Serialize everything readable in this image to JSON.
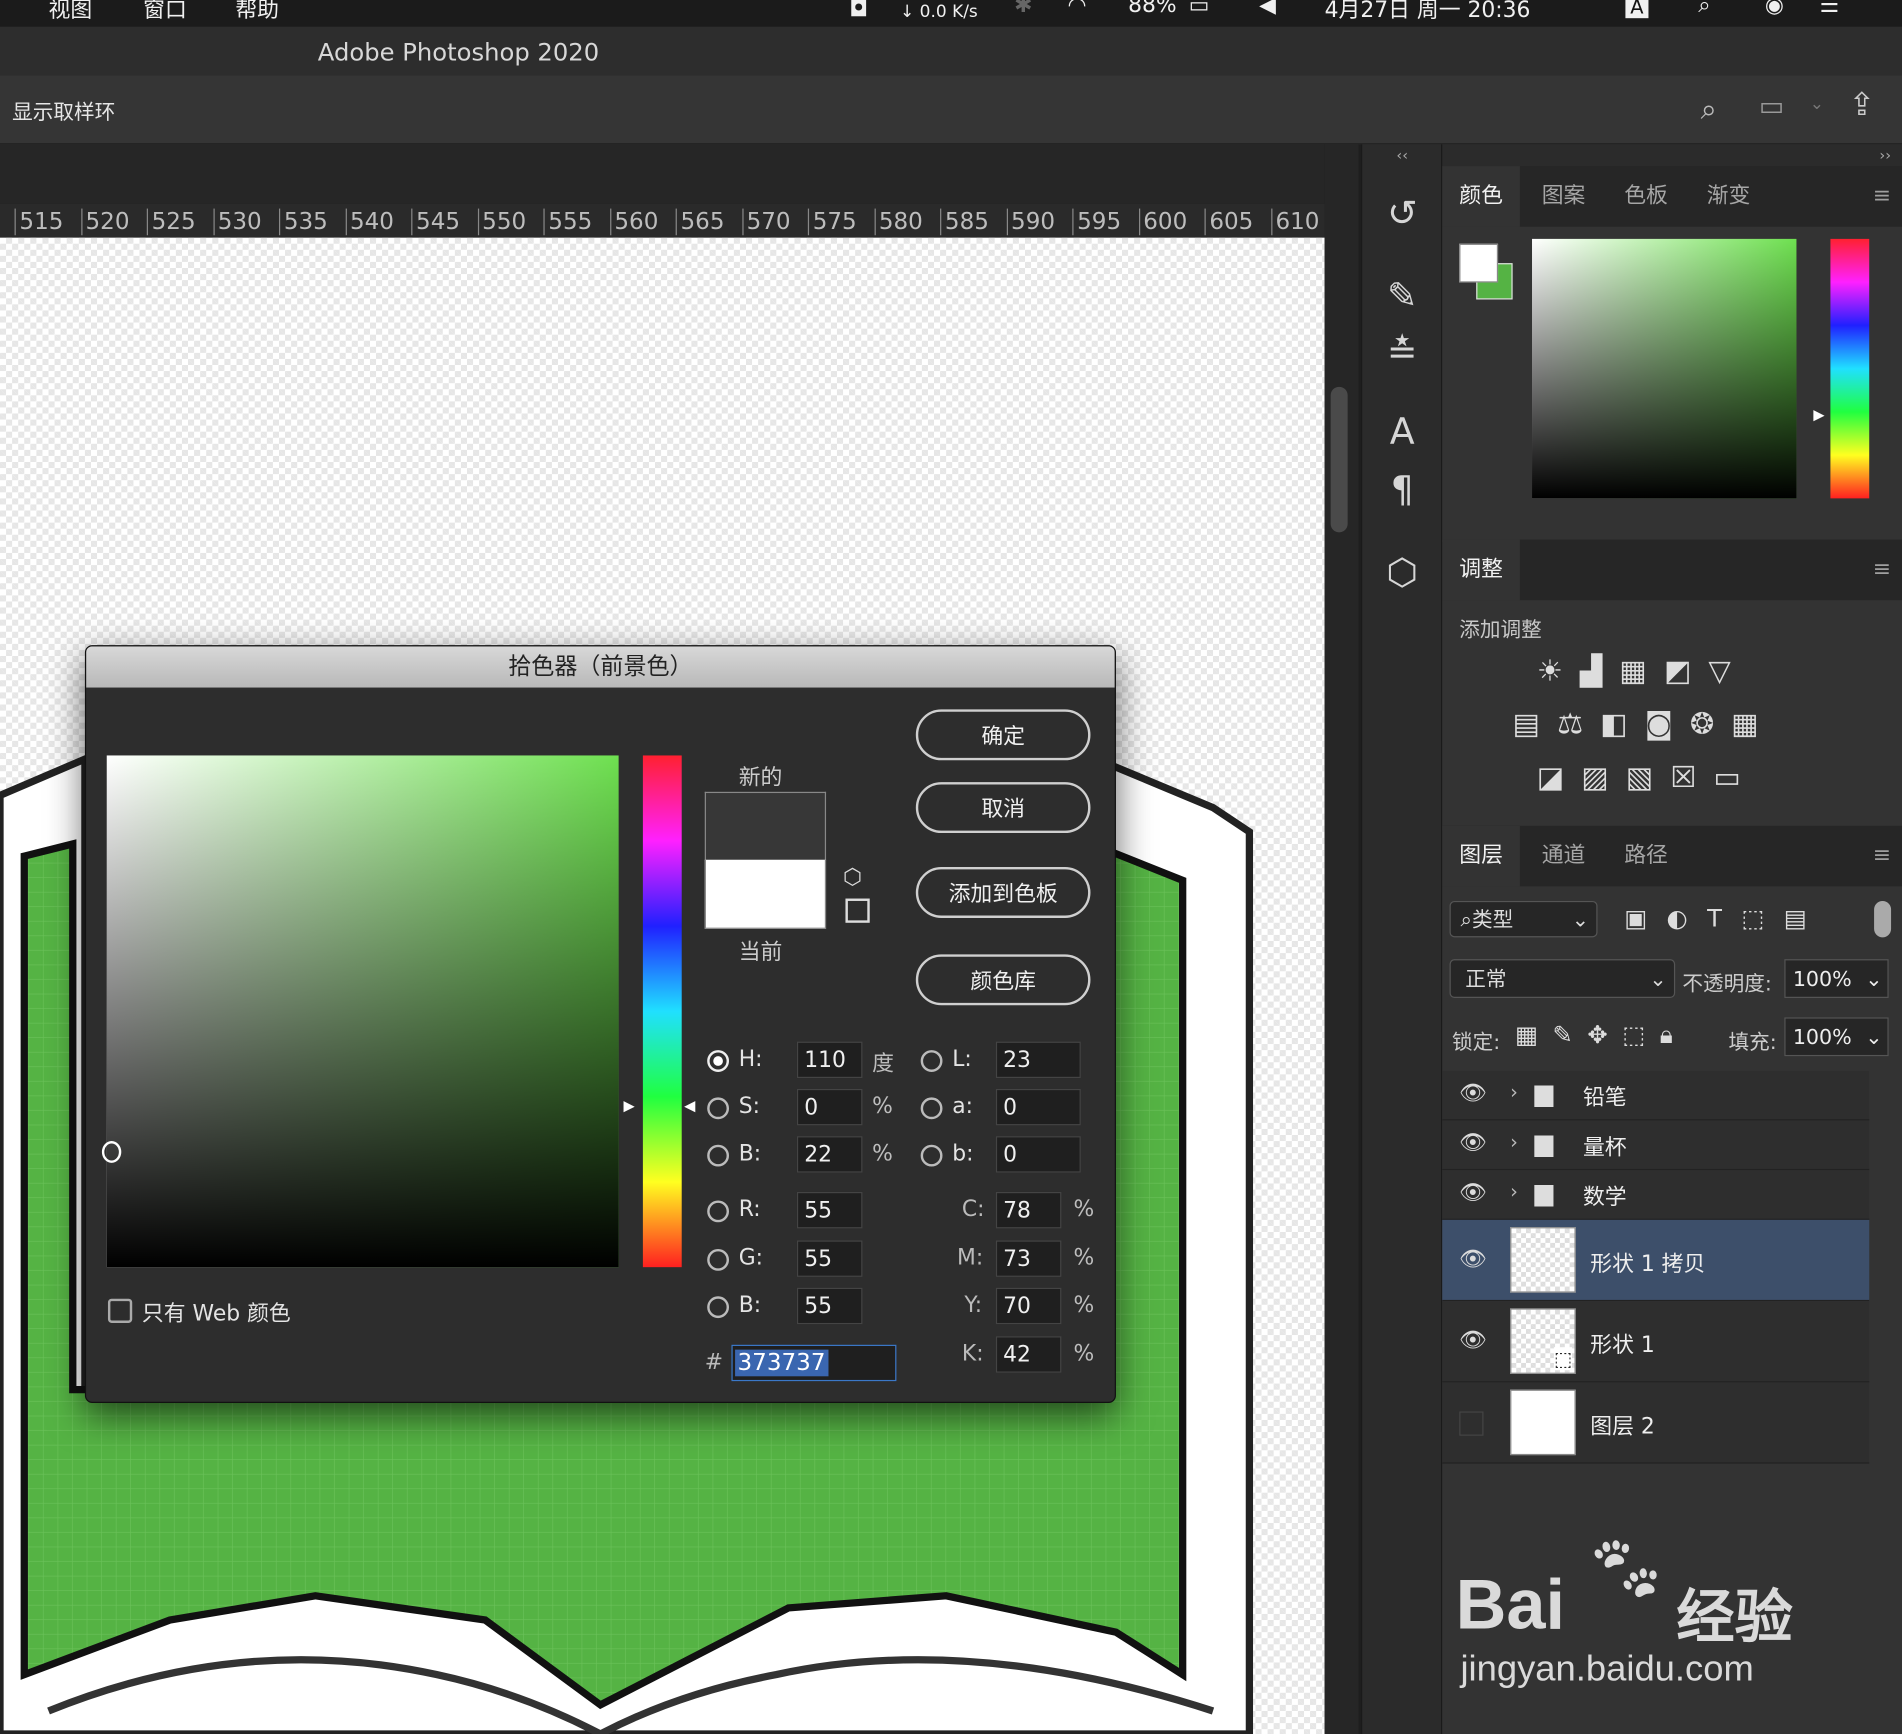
{
  "menubar": {
    "items": [
      "视图",
      "窗口",
      "帮助"
    ],
    "net_speed": "↓ 0.0 K/s",
    "battery": "88%",
    "date_time": "4月27日 周一 20:36",
    "input_method": "A"
  },
  "app": {
    "title": "Adobe Photoshop 2020"
  },
  "options": {
    "show_sampling_ring": "显示取样环"
  },
  "ruler": {
    "ticks": [
      "515",
      "520",
      "525",
      "530",
      "535",
      "540",
      "545",
      "550",
      "555",
      "560",
      "565",
      "570",
      "575",
      "580",
      "585",
      "590",
      "595",
      "600",
      "605",
      "610"
    ]
  },
  "color_panel": {
    "tabs": [
      "颜色",
      "图案",
      "色板",
      "渐变"
    ],
    "active": "颜色"
  },
  "adjust_panel": {
    "tab": "调整",
    "label": "添加调整"
  },
  "layers_panel": {
    "tabs": [
      "图层",
      "通道",
      "路径"
    ],
    "filter": "类型",
    "blend_mode": "正常",
    "opacity_label": "不透明度:",
    "opacity": "100%",
    "lock_label": "锁定:",
    "fill_label": "填充:",
    "fill": "100%",
    "layers": [
      {
        "name": "铅笔",
        "kind": "group",
        "visible": true
      },
      {
        "name": "量杯",
        "kind": "group",
        "visible": true
      },
      {
        "name": "数学",
        "kind": "group",
        "visible": true
      },
      {
        "name": "形状 1 拷贝",
        "kind": "shape",
        "visible": true,
        "selected": true
      },
      {
        "name": "形状 1",
        "kind": "shape",
        "visible": true
      },
      {
        "name": "图层 2",
        "kind": "pixel",
        "visible": false
      }
    ]
  },
  "picker": {
    "title": "拾色器（前景色）",
    "new_label": "新的",
    "current_label": "当前",
    "buttons": {
      "ok": "确定",
      "cancel": "取消",
      "add_swatch": "添加到色板",
      "library": "颜色库"
    },
    "web_only": "只有 Web 颜色",
    "H": "110",
    "H_unit": "度",
    "S": "0",
    "S_unit": "%",
    "B": "22",
    "B_unit": "%",
    "R": "55",
    "G": "55",
    "B2": "55",
    "L": "23",
    "a": "0",
    "b": "0",
    "C": "78",
    "M": "73",
    "Y": "70",
    "K": "42",
    "pct": "%",
    "hex": "373737",
    "labels": {
      "H": "H:",
      "S": "S:",
      "B": "B:",
      "R": "R:",
      "G": "G:",
      "B2": "B:",
      "L": "L:",
      "a": "a:",
      "b": "b:",
      "C": "C:",
      "M": "M:",
      "Y": "Y:",
      "K": "K:",
      "hash": "#"
    },
    "new_color": "#373737",
    "current_color": "#ffffff"
  },
  "watermark": {
    "brand": "Bai",
    "brand_suffix": "经验",
    "url": "jingyan.baidu.com"
  },
  "colors": {
    "accent_green": "#55b344",
    "selection": "#3d4f6a"
  }
}
